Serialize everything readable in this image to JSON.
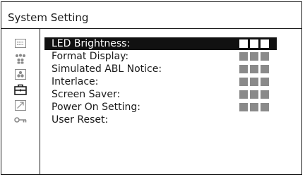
{
  "window": {
    "title": "System Setting"
  },
  "sidebar": {
    "icons": [
      {
        "name": "status-icon",
        "active": false
      },
      {
        "name": "user-group-icon",
        "active": false
      },
      {
        "name": "color-icon",
        "active": false
      },
      {
        "name": "toolbox-icon",
        "active": true
      },
      {
        "name": "arrow-icon",
        "active": false
      },
      {
        "name": "key-icon",
        "active": false
      }
    ]
  },
  "menu": {
    "items": [
      {
        "label": "LED Brightness:",
        "selected": true,
        "has_value": true
      },
      {
        "label": "Format Display:",
        "selected": false,
        "has_value": true
      },
      {
        "label": "Simulated ABL Notice:",
        "selected": false,
        "has_value": true
      },
      {
        "label": "Interlace:",
        "selected": false,
        "has_value": true
      },
      {
        "label": "Screen Saver:",
        "selected": false,
        "has_value": true
      },
      {
        "label": "Power On Setting:",
        "selected": false,
        "has_value": true
      },
      {
        "label": "User Reset:",
        "selected": false,
        "has_value": false
      }
    ]
  },
  "colors": {
    "selected_bg": "#111111",
    "placeholder_gray": "#8a8a8a",
    "text": "#1a1a1a"
  }
}
